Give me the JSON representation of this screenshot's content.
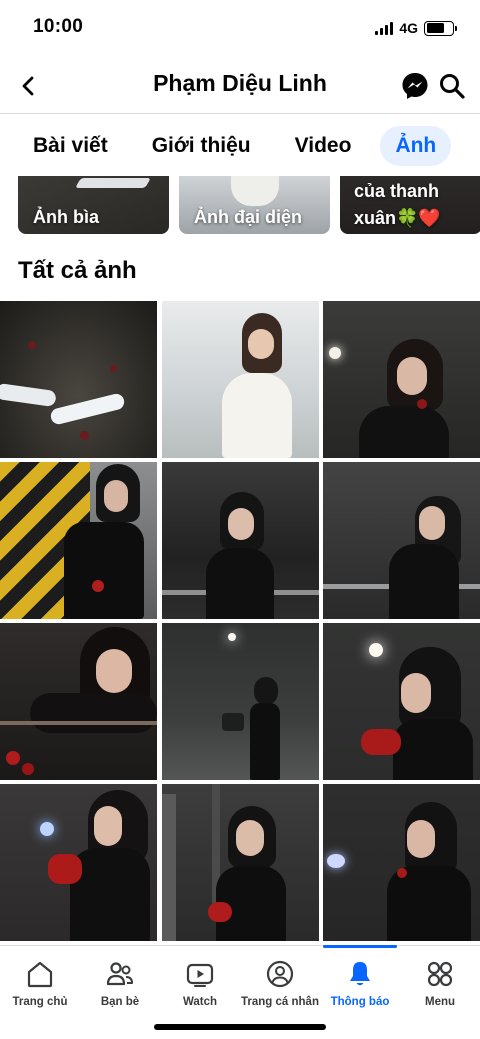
{
  "status": {
    "time": "10:00",
    "network": "4G",
    "battery_level": 0.7
  },
  "header": {
    "title": "Phạm Diệu Linh",
    "icons": [
      "back-arrow-icon",
      "messenger-icon",
      "search-icon"
    ]
  },
  "tabs": [
    {
      "label": "Bài viết",
      "active": false
    },
    {
      "label": "Giới thiệu",
      "active": false
    },
    {
      "label": "Video",
      "active": false
    },
    {
      "label": "Ảnh",
      "active": true
    }
  ],
  "albums": [
    {
      "label": "Ảnh bìa"
    },
    {
      "label": "Ảnh đại diện"
    },
    {
      "label": "của thanh xuân🍀❤️"
    }
  ],
  "section": {
    "title": "Tất cả ảnh"
  },
  "photos_count": 12,
  "bottom_nav": [
    {
      "label": "Trang chủ",
      "icon": "home-icon",
      "active": false
    },
    {
      "label": "Bạn bè",
      "icon": "friends-icon",
      "active": false
    },
    {
      "label": "Watch",
      "icon": "watch-icon",
      "active": false
    },
    {
      "label": "Trang cá nhân",
      "icon": "profile-icon",
      "active": false
    },
    {
      "label": "Thông báo",
      "icon": "bell-icon",
      "active": true
    },
    {
      "label": "Menu",
      "icon": "menu-grid-icon",
      "active": false
    }
  ],
  "colors": {
    "accent": "#0866ff",
    "accent_bg": "#e7f0ff",
    "text": "#050505",
    "divider": "#dcdde1"
  }
}
